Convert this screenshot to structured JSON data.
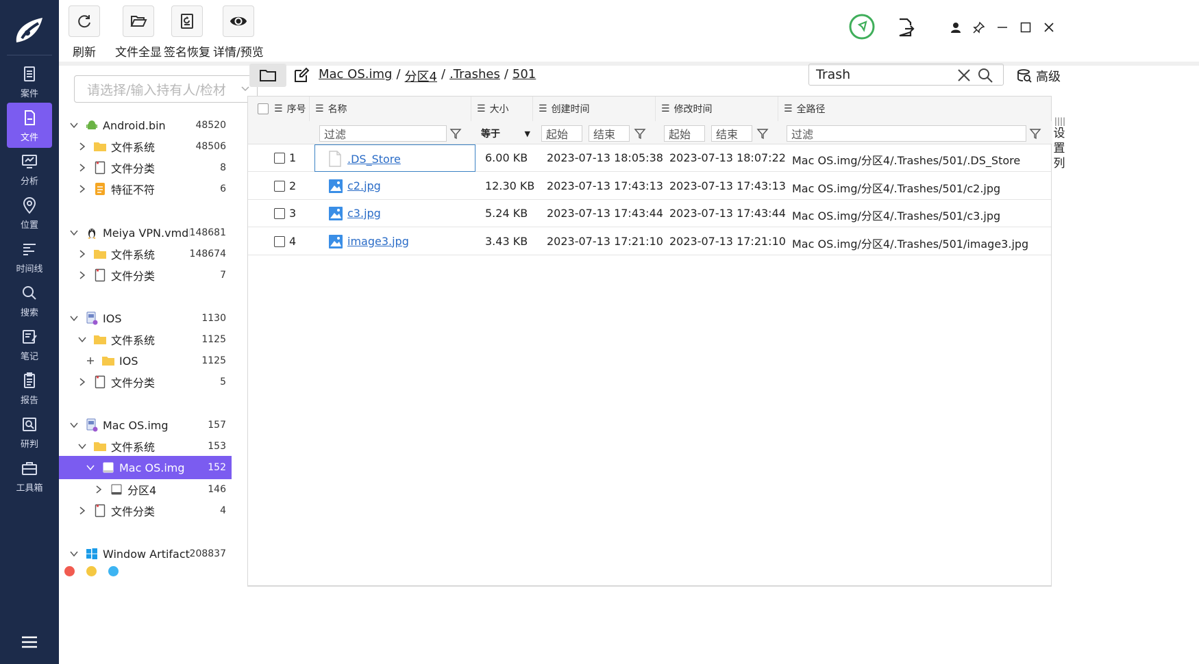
{
  "nav": {
    "items": [
      {
        "label": "案件",
        "icon": "case-icon"
      },
      {
        "label": "文件",
        "icon": "file-icon",
        "active": true
      },
      {
        "label": "分析",
        "icon": "analysis-icon"
      },
      {
        "label": "位置",
        "icon": "location-icon"
      },
      {
        "label": "时间线",
        "icon": "timeline-icon"
      },
      {
        "label": "搜索",
        "icon": "search-icon"
      },
      {
        "label": "笔记",
        "icon": "note-icon"
      },
      {
        "label": "报告",
        "icon": "report-icon"
      },
      {
        "label": "研判",
        "icon": "judge-icon"
      },
      {
        "label": "工具箱",
        "icon": "toolbox-icon"
      }
    ],
    "active_color": "#7b5cf0",
    "bg_color": "#1c2b4a"
  },
  "toolbar": {
    "refresh": "刷新",
    "show_all_files": "文件全显",
    "signature_recovery": "签名恢复",
    "detail_preview": "详情/预览"
  },
  "tree": {
    "owner_placeholder": "请选择/输入持有人/检材",
    "nodes": [
      {
        "label": "Android.bin",
        "count": "48520"
      },
      {
        "label": "文件系统",
        "count": "48506"
      },
      {
        "label": "文件分类",
        "count": "8"
      },
      {
        "label": "特征不符",
        "count": "6"
      },
      {
        "label": "Meiya VPN.vmdk",
        "count": "148681"
      },
      {
        "label": "文件系统",
        "count": "148674"
      },
      {
        "label": "文件分类",
        "count": "7"
      },
      {
        "label": "IOS",
        "count": "1130"
      },
      {
        "label": "文件系统",
        "count": "1125"
      },
      {
        "label": "IOS",
        "count": "1125"
      },
      {
        "label": "文件分类",
        "count": "5"
      },
      {
        "label": "Mac OS.img",
        "count": "157"
      },
      {
        "label": "文件系统",
        "count": "153"
      },
      {
        "label": "Mac OS.img",
        "count": "152",
        "selected": true
      },
      {
        "label": "分区4",
        "count": "146"
      },
      {
        "label": "文件分类",
        "count": "4"
      },
      {
        "label": "Window Artifacts....",
        "count": "208837"
      }
    ],
    "dot_colors": [
      "#f15b50",
      "#f5c842",
      "#3db4f2"
    ]
  },
  "path": {
    "crumbs": [
      "Mac OS.img",
      "分区4",
      ".Trashes",
      "501"
    ],
    "separator": "/"
  },
  "search": {
    "value": "Trash",
    "advanced_label": "高级"
  },
  "table": {
    "headers": {
      "index": "序号",
      "name": "名称",
      "size": "大小",
      "created": "创建时间",
      "modified": "修改时间",
      "fullpath": "全路径"
    },
    "filters": {
      "name_placeholder": "过滤",
      "size_op": "等于",
      "created_start": "起始",
      "created_end": "结束",
      "modified_start": "起始",
      "modified_end": "结束",
      "path_placeholder": "过滤"
    },
    "rows": [
      {
        "index": "1",
        "name": ".DS_Store",
        "type": "file",
        "size": "6.00 KB",
        "created": "2023-07-13 18:05:38",
        "modified": "2023-07-13 18:07:22",
        "path": "Mac OS.img/分区4/.Trashes/501/.DS_Store"
      },
      {
        "index": "2",
        "name": "c2.jpg",
        "type": "image",
        "size": "12.30 KB",
        "created": "2023-07-13 17:43:13",
        "modified": "2023-07-13 17:43:13",
        "path": "Mac OS.img/分区4/.Trashes/501/c2.jpg"
      },
      {
        "index": "3",
        "name": "c3.jpg",
        "type": "image",
        "size": "5.24 KB",
        "created": "2023-07-13 17:43:44",
        "modified": "2023-07-13 17:43:44",
        "path": "Mac OS.img/分区4/.Trashes/501/c3.jpg"
      },
      {
        "index": "4",
        "name": "image3.jpg",
        "type": "image",
        "size": "3.43 KB",
        "created": "2023-07-13 17:21:10",
        "modified": "2023-07-13 17:21:10",
        "path": "Mac OS.img/分区4/.Trashes/501/image3.jpg"
      }
    ],
    "column_settings": "设置列"
  }
}
